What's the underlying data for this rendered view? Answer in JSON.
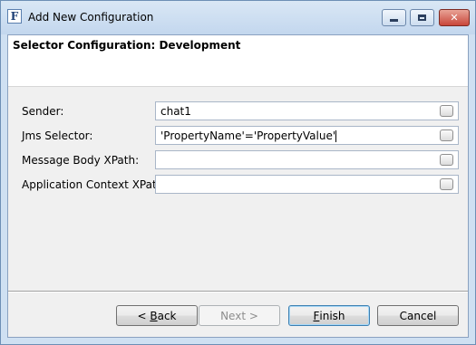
{
  "window": {
    "title": "Add New Configuration",
    "app_icon_letter": "F",
    "close_glyph": "✕"
  },
  "banner": {
    "title": "Selector Configuration: Development"
  },
  "form": {
    "fields": [
      {
        "label": "Sender:",
        "value": "chat1"
      },
      {
        "label": "Jms Selector:",
        "value": "'PropertyName'='PropertyValue'"
      },
      {
        "label": "Message Body XPath:",
        "value": ""
      },
      {
        "label": "Application Context XPath:",
        "value": ""
      }
    ]
  },
  "buttons": {
    "back_prefix": "< ",
    "back_underlined": "B",
    "back_rest": "ack",
    "next": "Next >",
    "finish_underlined": "F",
    "finish_rest": "inish",
    "cancel": "Cancel"
  }
}
